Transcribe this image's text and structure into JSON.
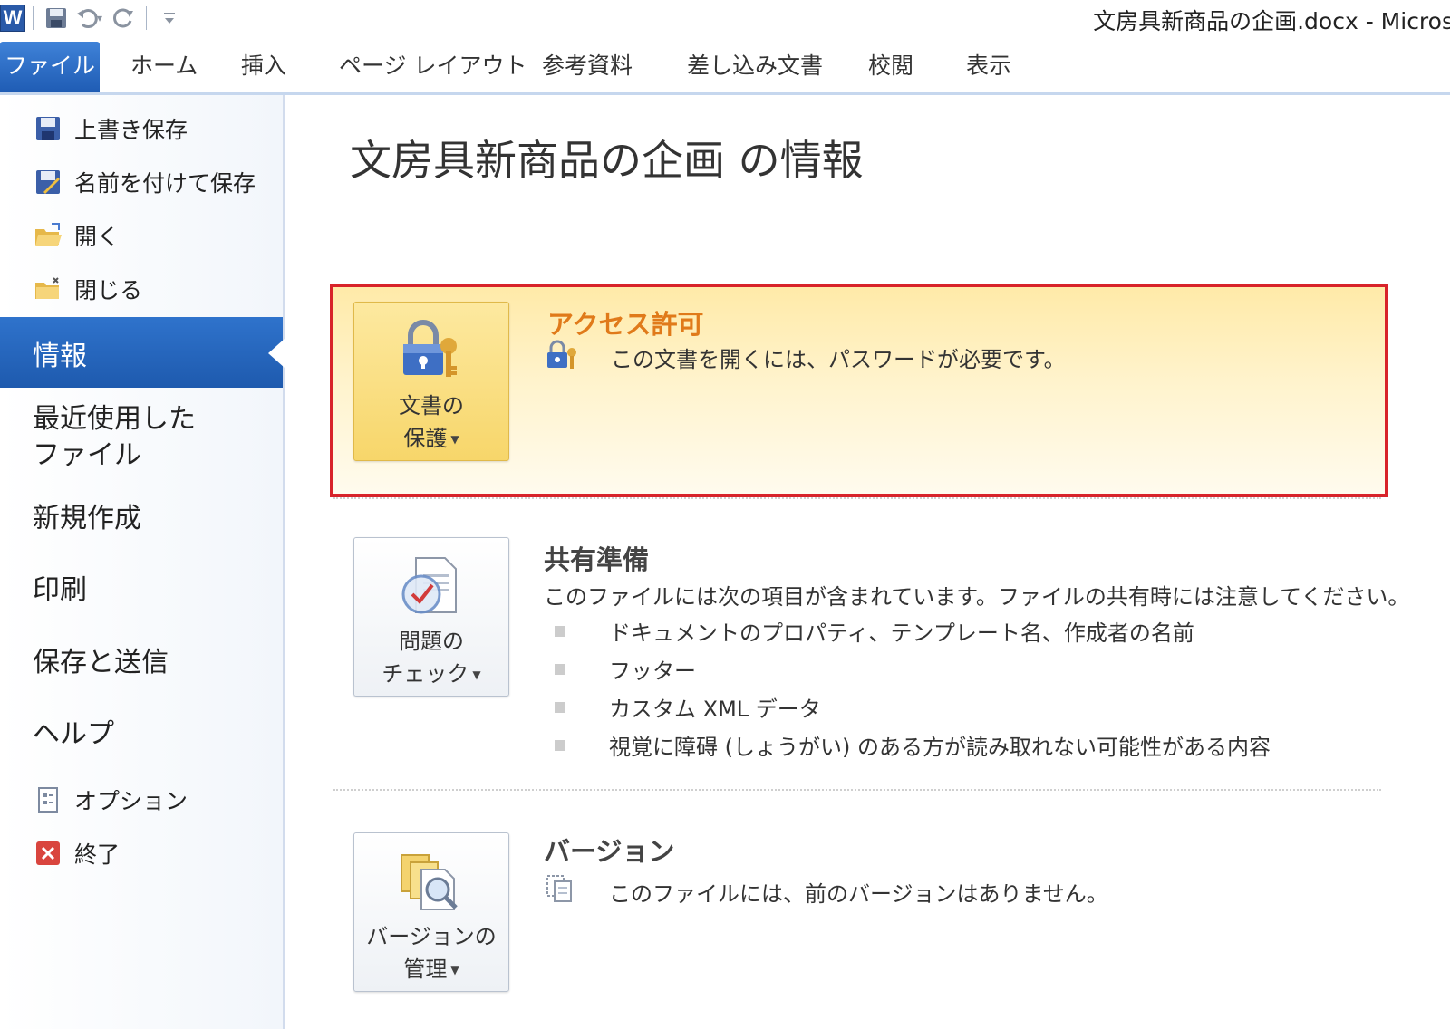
{
  "window": {
    "title": "文房具新商品の企画.docx  -  Micros",
    "app_logo": "W"
  },
  "ribbon": {
    "tabs": [
      "ファイル",
      "ホーム",
      "挿入",
      "ページ レイアウト",
      "参考資料",
      "差し込み文書",
      "校閲",
      "表示"
    ]
  },
  "backstage_nav": {
    "commands_top": [
      {
        "label": "上書き保存",
        "icon": "save-icon"
      },
      {
        "label": "名前を付けて保存",
        "icon": "save-as-icon"
      },
      {
        "label": "開く",
        "icon": "open-folder-icon"
      },
      {
        "label": "閉じる",
        "icon": "close-folder-icon"
      }
    ],
    "selected": "情報",
    "tabs": [
      "最近使用した",
      "ファイル",
      "新規作成",
      "印刷",
      "保存と送信",
      "ヘルプ"
    ],
    "commands_bottom": [
      {
        "label": "オプション",
        "icon": "options-icon"
      },
      {
        "label": "終了",
        "icon": "exit-icon"
      }
    ]
  },
  "info": {
    "page_title": "文房具新商品の企画 の情報",
    "access": {
      "button_line1": "文書の",
      "button_line2": "保護",
      "heading": "アクセス許可",
      "text": "この文書を開くには、パスワードが必要です。"
    },
    "share": {
      "button_line1": "問題の",
      "button_line2": "チェック",
      "heading": "共有準備",
      "text": "このファイルには次の項目が含まれています。ファイルの共有時には注意してください。",
      "items": [
        "ドキュメントのプロパティ、テンプレート名、作成者の名前",
        "フッター",
        "カスタム XML データ",
        "視覚に障碍 (しょうがい) のある方が読み取れない可能性がある内容"
      ]
    },
    "versions": {
      "button_line1": "バージョンの",
      "button_line2": "管理",
      "heading": "バージョン",
      "text": "このファイルには、前のバージョンはありません。"
    }
  },
  "colors": {
    "accent_blue": "#2b6cc6",
    "access_heading": "#e07a1a",
    "highlight_border": "#d8232a",
    "highlight_fill": "#fff3cc"
  }
}
